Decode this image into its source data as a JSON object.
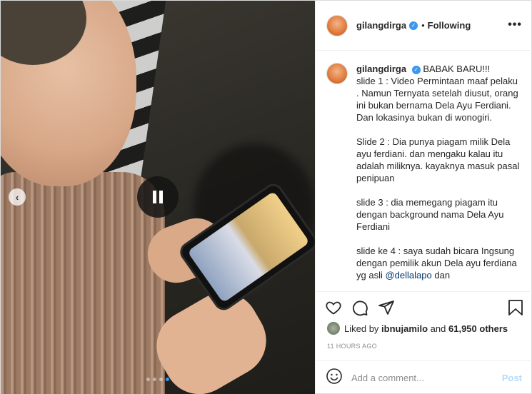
{
  "post": {
    "author": "gilangdirga",
    "separator": "•",
    "follow_status": "Following",
    "more_label": "•••"
  },
  "caption": {
    "author": "gilangdirga",
    "lines": [
      "BABAK BARU!!!",
      "slide 1 : Video Permintaan maaf pelaku . Namun Ternyata setelah diusut, orang ini bukan bernama Dela Ayu Ferdiani. Dan lokasinya bukan di wonogiri.",
      "",
      "Slide 2 : Dia punya piagam milik Dela ayu ferdiani. dan mengaku kalau itu adalah miliknya. kayaknya masuk pasal penipuan",
      "",
      "slide 3 : dia memegang piagam itu dengan background nama Dela Ayu Ferdiani",
      "",
      "slide ke 4 : saya sudah bicara Ingsung dengan pemilik akun Dela ayu ferdiana yg asli"
    ],
    "mention": "@dellalapo",
    "trailing": "dan"
  },
  "likes": {
    "prefix": "Liked by",
    "user": "ibnujamilo",
    "conjunction": "and",
    "others": "61,950 others"
  },
  "timestamp": "11 HOURS AGO",
  "comment": {
    "placeholder": "Add a comment...",
    "post_label": "Post"
  },
  "media": {
    "pause_icon": "pause-icon",
    "prev_icon": "chevron-left-icon",
    "slide_count": 4,
    "active_slide": 4
  },
  "colors": {
    "accent": "#3897f0",
    "post_disabled": "#b3dbff"
  }
}
